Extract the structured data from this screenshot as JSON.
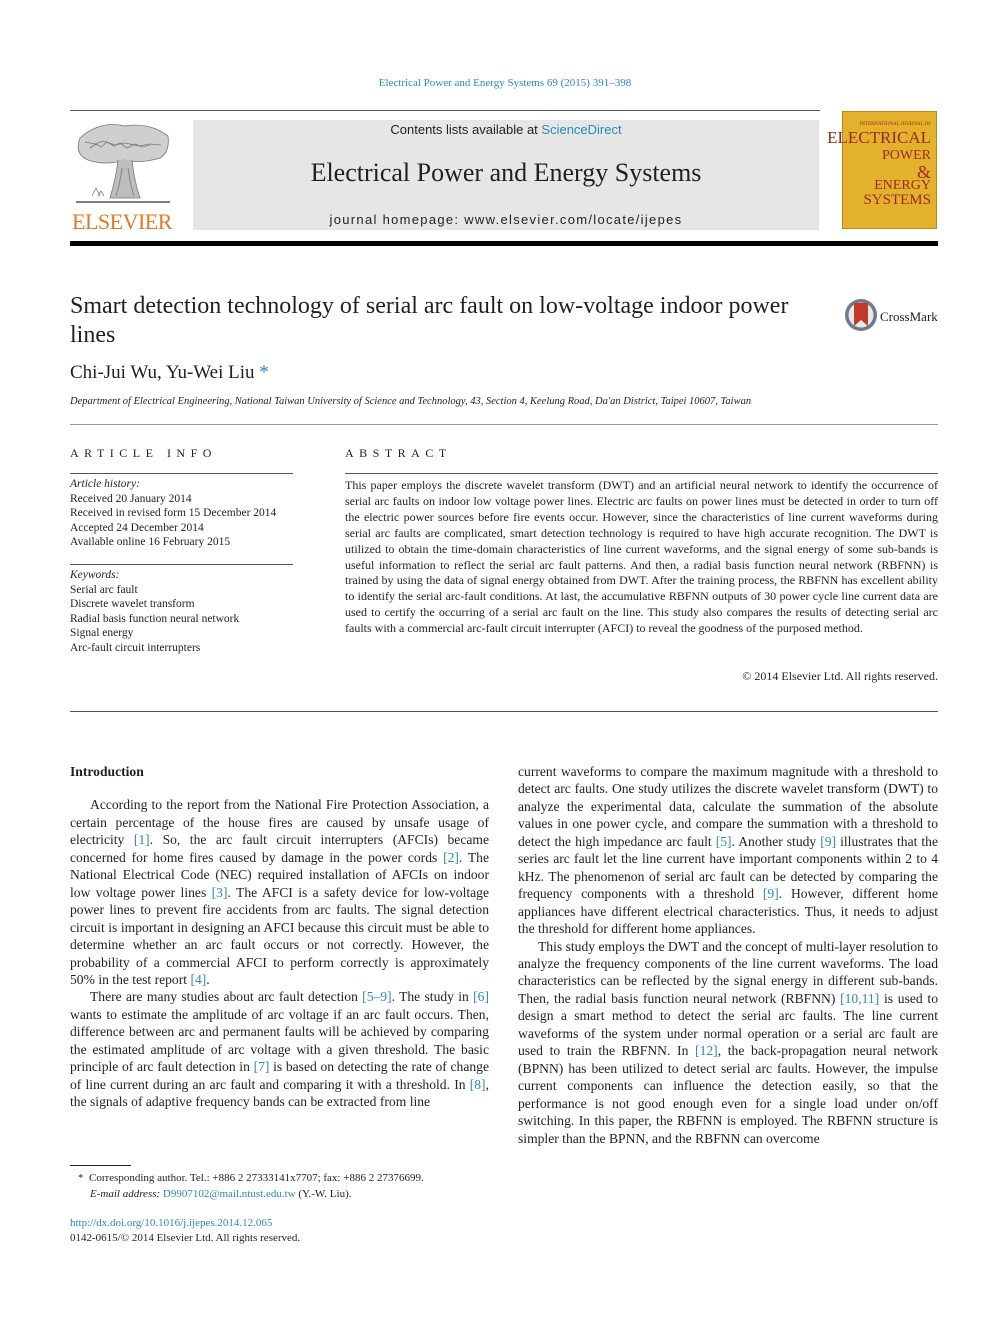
{
  "header": {
    "citation": "Electrical Power and Energy Systems 69 (2015) 391–398",
    "publisher_logo_text": "ELSEVIER",
    "contents_prefix": "Contents lists available at ",
    "contents_link": "ScienceDirect",
    "journal_name": "Electrical Power and Energy Systems",
    "homepage_label": "journal homepage: www.elsevier.com/locate/ijepes",
    "cover": {
      "small": "INTERNATIONAL JOURNAL OF",
      "line1": "ELECTRICAL",
      "line2": "POWER",
      "line3": "&",
      "line4": "ENERGY",
      "line5": "SYSTEMS",
      "background": "#e3b12b",
      "text_color": "#9b2a1c"
    },
    "colors": {
      "link": "#2a8ab8",
      "elsevier_orange": "#e87722"
    }
  },
  "article": {
    "title": "Smart detection technology of serial arc fault on low-voltage indoor power lines",
    "crossmark_label": "CrossMark",
    "authors": "Chi-Jui Wu, Yu-Wei Liu",
    "author_mark": "*",
    "affiliation": "Department of Electrical Engineering, National Taiwan University of Science and Technology, 43, Section 4, Keelung Road, Da'an District, Taipei 10607, Taiwan"
  },
  "article_info": {
    "heading": "ARTICLE INFO",
    "history_label": "Article history:",
    "history": [
      "Received 20 January 2014",
      "Received in revised form 15 December 2014",
      "Accepted 24 December 2014",
      "Available online 16 February 2015"
    ],
    "keywords_label": "Keywords:",
    "keywords": [
      "Serial arc fault",
      "Discrete wavelet transform",
      "Radial basis function neural network",
      "Signal energy",
      "Arc-fault circuit interrupters"
    ]
  },
  "abstract": {
    "heading": "ABSTRACT",
    "text": "This paper employs the discrete wavelet transform (DWT) and an artificial neural network to identify the occurrence of serial arc faults on indoor low voltage power lines. Electric arc faults on power lines must be detected in order to turn off the electric power sources before fire events occur. However, since the characteristics of line current waveforms during serial arc faults are complicated, smart detection technology is required to have high accurate recognition. The DWT is utilized to obtain the time-domain characteristics of line current waveforms, and the signal energy of some sub-bands is useful information to reflect the serial arc fault patterns. And then, a radial basis function neural network (RBFNN) is trained by using the data of signal energy obtained from DWT. After the training process, the RBFNN has excellent ability to identify the serial arc-fault conditions. At last, the accumulative RBFNN outputs of 30 power cycle line current data are used to certify the occurring of a serial arc fault on the line. This study also compares the results of detecting serial arc faults with a commercial arc-fault circuit interrupter (AFCI) to reveal the goodness of the purposed method.",
    "copyright": "© 2014 Elsevier Ltd. All rights reserved."
  },
  "body": {
    "intro_heading": "Introduction",
    "left": {
      "p1": [
        {
          "t": "According to the report from the National Fire Protection Association, a certain percentage of the house fires are caused by unsafe usage of electricity "
        },
        {
          "ref": "[1]"
        },
        {
          "t": ". So, the arc fault circuit interrupters (AFCIs) became concerned for home fires caused by damage in the power cords "
        },
        {
          "ref": "[2]"
        },
        {
          "t": ". The National Electrical Code (NEC) required installation of AFCIs on indoor low voltage power lines "
        },
        {
          "ref": "[3]"
        },
        {
          "t": ". The AFCI is a safety device for low-voltage power lines to prevent fire accidents from arc faults. The signal detection circuit is important in designing an AFCI because this circuit must be able to determine whether an arc fault occurs or not correctly. However, the probability of a commercial AFCI to perform correctly is approximately 50% in the test report "
        },
        {
          "ref": "[4]"
        },
        {
          "t": "."
        }
      ],
      "p2": [
        {
          "t": "There are many studies about arc fault detection "
        },
        {
          "ref": "[5–9]"
        },
        {
          "t": ". The study in "
        },
        {
          "ref": "[6]"
        },
        {
          "t": " wants to estimate the amplitude of arc voltage if an arc fault occurs. Then, difference between arc and permanent faults will be achieved by comparing the estimated amplitude of arc voltage with a given threshold. The basic principle of arc fault detection in "
        },
        {
          "ref": "[7]"
        },
        {
          "t": " is based on detecting the rate of change of line current during an arc fault and comparing it with a threshold. In "
        },
        {
          "ref": "[8]"
        },
        {
          "t": ", the signals of adaptive frequency bands can be extracted from line"
        }
      ]
    },
    "right": {
      "p1": [
        {
          "t": "current waveforms to compare the maximum magnitude with a threshold to detect arc faults. One study utilizes the discrete wavelet transform (DWT) to analyze the experimental data, calculate the summation of the absolute values in one power cycle, and compare the summation with a threshold to detect the high impedance arc fault "
        },
        {
          "ref": "[5]"
        },
        {
          "t": ". Another study "
        },
        {
          "ref": "[9]"
        },
        {
          "t": " illustrates that the series arc fault let the line current have important components within 2 to 4 kHz. The phenomenon of serial arc fault can be detected by comparing the frequency components with a threshold "
        },
        {
          "ref": "[9]"
        },
        {
          "t": ". However, different home appliances have different electrical characteristics. Thus, it needs to adjust the threshold for different home appliances."
        }
      ],
      "p2": [
        {
          "t": "This study employs the DWT and the concept of multi-layer resolution to analyze the frequency components of the line current waveforms. The load characteristics can be reflected by the signal energy in different sub-bands. Then, the radial basis function neural network (RBFNN) "
        },
        {
          "ref": "[10,11]"
        },
        {
          "t": " is used to design a smart method to detect the serial arc faults. The line current waveforms of the system under normal operation or a serial arc fault are used to train the RBFNN. In "
        },
        {
          "ref": "[12]"
        },
        {
          "t": ", the back-propagation neural network (BPNN) has been utilized to detect serial arc faults. However, the impulse current components can influence the detection easily, so that the performance is not good enough even for a single load under on/off switching. In this paper, the RBFNN is employed. The RBFNN structure is simpler than the BPNN, and the RBFNN can overcome"
        }
      ]
    }
  },
  "footnote": {
    "mark": "*",
    "corresponding": "Corresponding author. Tel.: +886 2 27333141x7707; fax: +886 2 27376699.",
    "email_label": "E-mail address:",
    "email": "D9907102@mail.ntust.edu.tw",
    "email_suffix": " (Y.-W. Liu).",
    "doi": "http://dx.doi.org/10.1016/j.ijepes.2014.12.065",
    "issn_line": "0142-0615/© 2014 Elsevier Ltd. All rights reserved."
  }
}
